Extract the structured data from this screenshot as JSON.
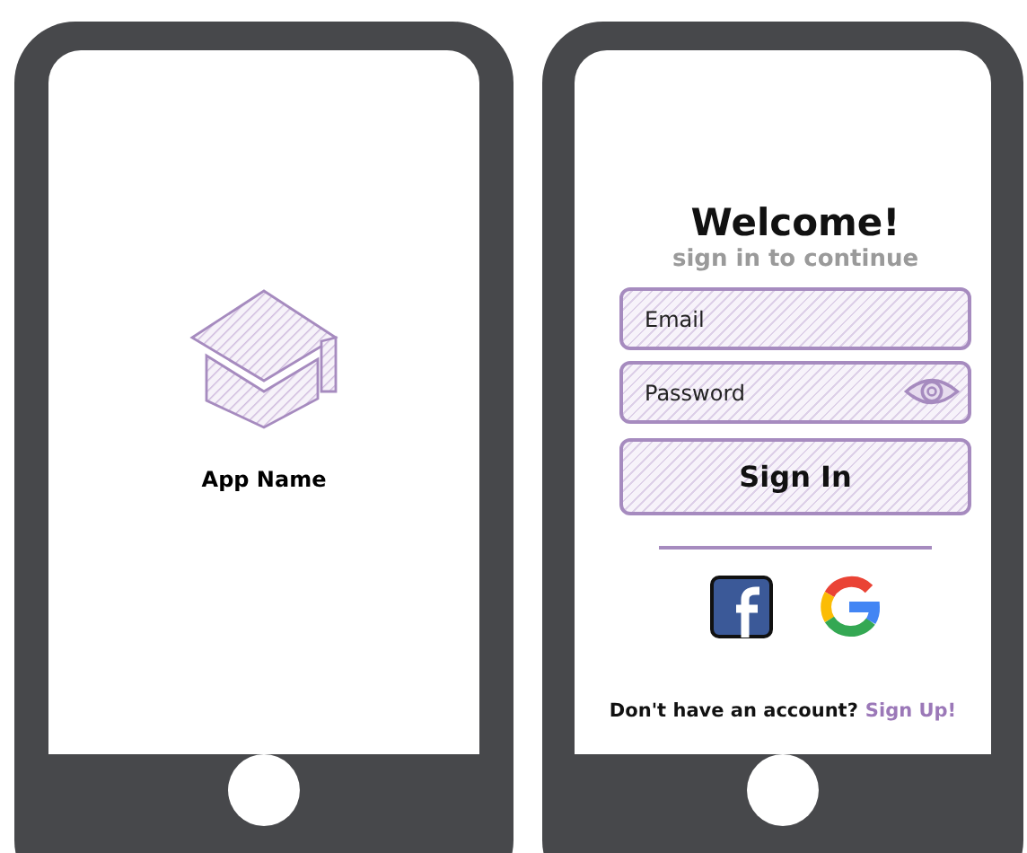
{
  "screens": [
    {
      "kind": "splash",
      "app_name": "App Name"
    },
    {
      "kind": "login",
      "title": "Welcome!",
      "subtitle": "sign in to continue",
      "email": {
        "placeholder": "Email"
      },
      "password": {
        "placeholder": "Password"
      },
      "submit": "Sign In",
      "social": [
        {
          "kind": "facebook"
        },
        {
          "kind": "google"
        }
      ],
      "footer": {
        "text": "Don't have an account?",
        "link": "Sign Up!"
      }
    }
  ]
}
